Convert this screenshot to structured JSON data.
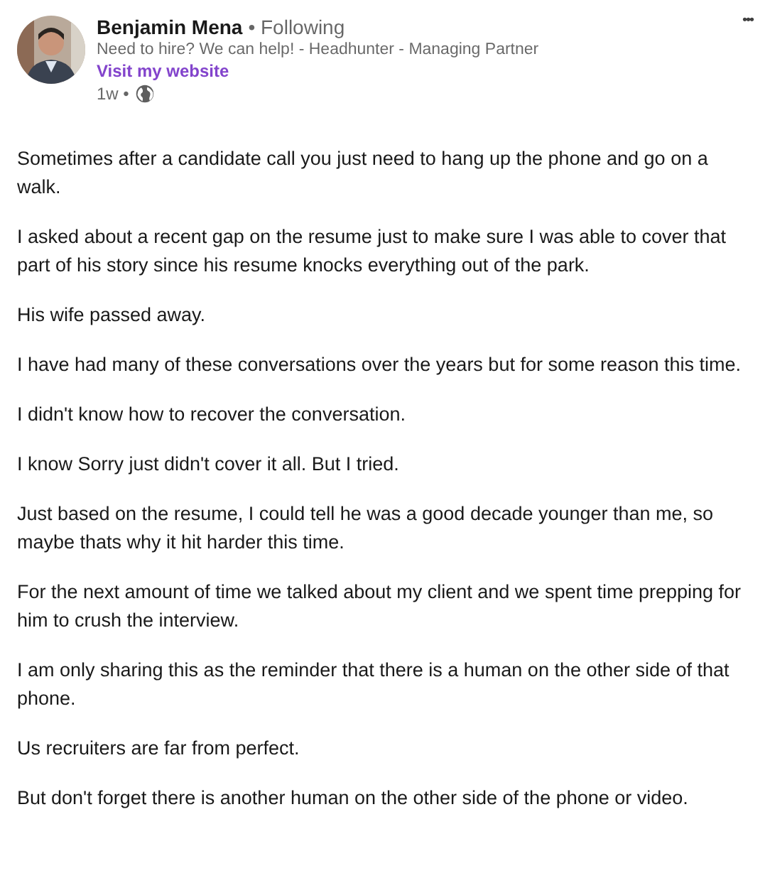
{
  "author": {
    "name": "Benjamin Mena",
    "connection": "• Following",
    "headline": "Need to hire? We can help! - Headhunter - Managing Partner",
    "link": "Visit my website",
    "time": "1w •"
  },
  "menu": "•••",
  "paragraphs": [
    "Sometimes after a candidate call you just need to hang up the phone and go on a walk.",
    "I asked about a recent gap on the resume just to make sure I was able to cover that part of his story since his resume knocks everything out of the park.",
    "His wife passed away.",
    "I have had many of these conversations over the years but for some reason this time.",
    "I didn't know how to recover the conversation.",
    "I know Sorry just didn't cover it all. But I tried.",
    "Just based on the resume, I could tell he was a good decade younger than me, so maybe thats why it hit harder this time.",
    "For the next amount of time we talked about my client and we spent time prepping for him to crush the interview.",
    "I am only sharing this as the reminder that there is a human on the other side of that phone.",
    "Us recruiters are far from perfect.",
    "But don't forget there is another human on the other side of the phone or video."
  ]
}
